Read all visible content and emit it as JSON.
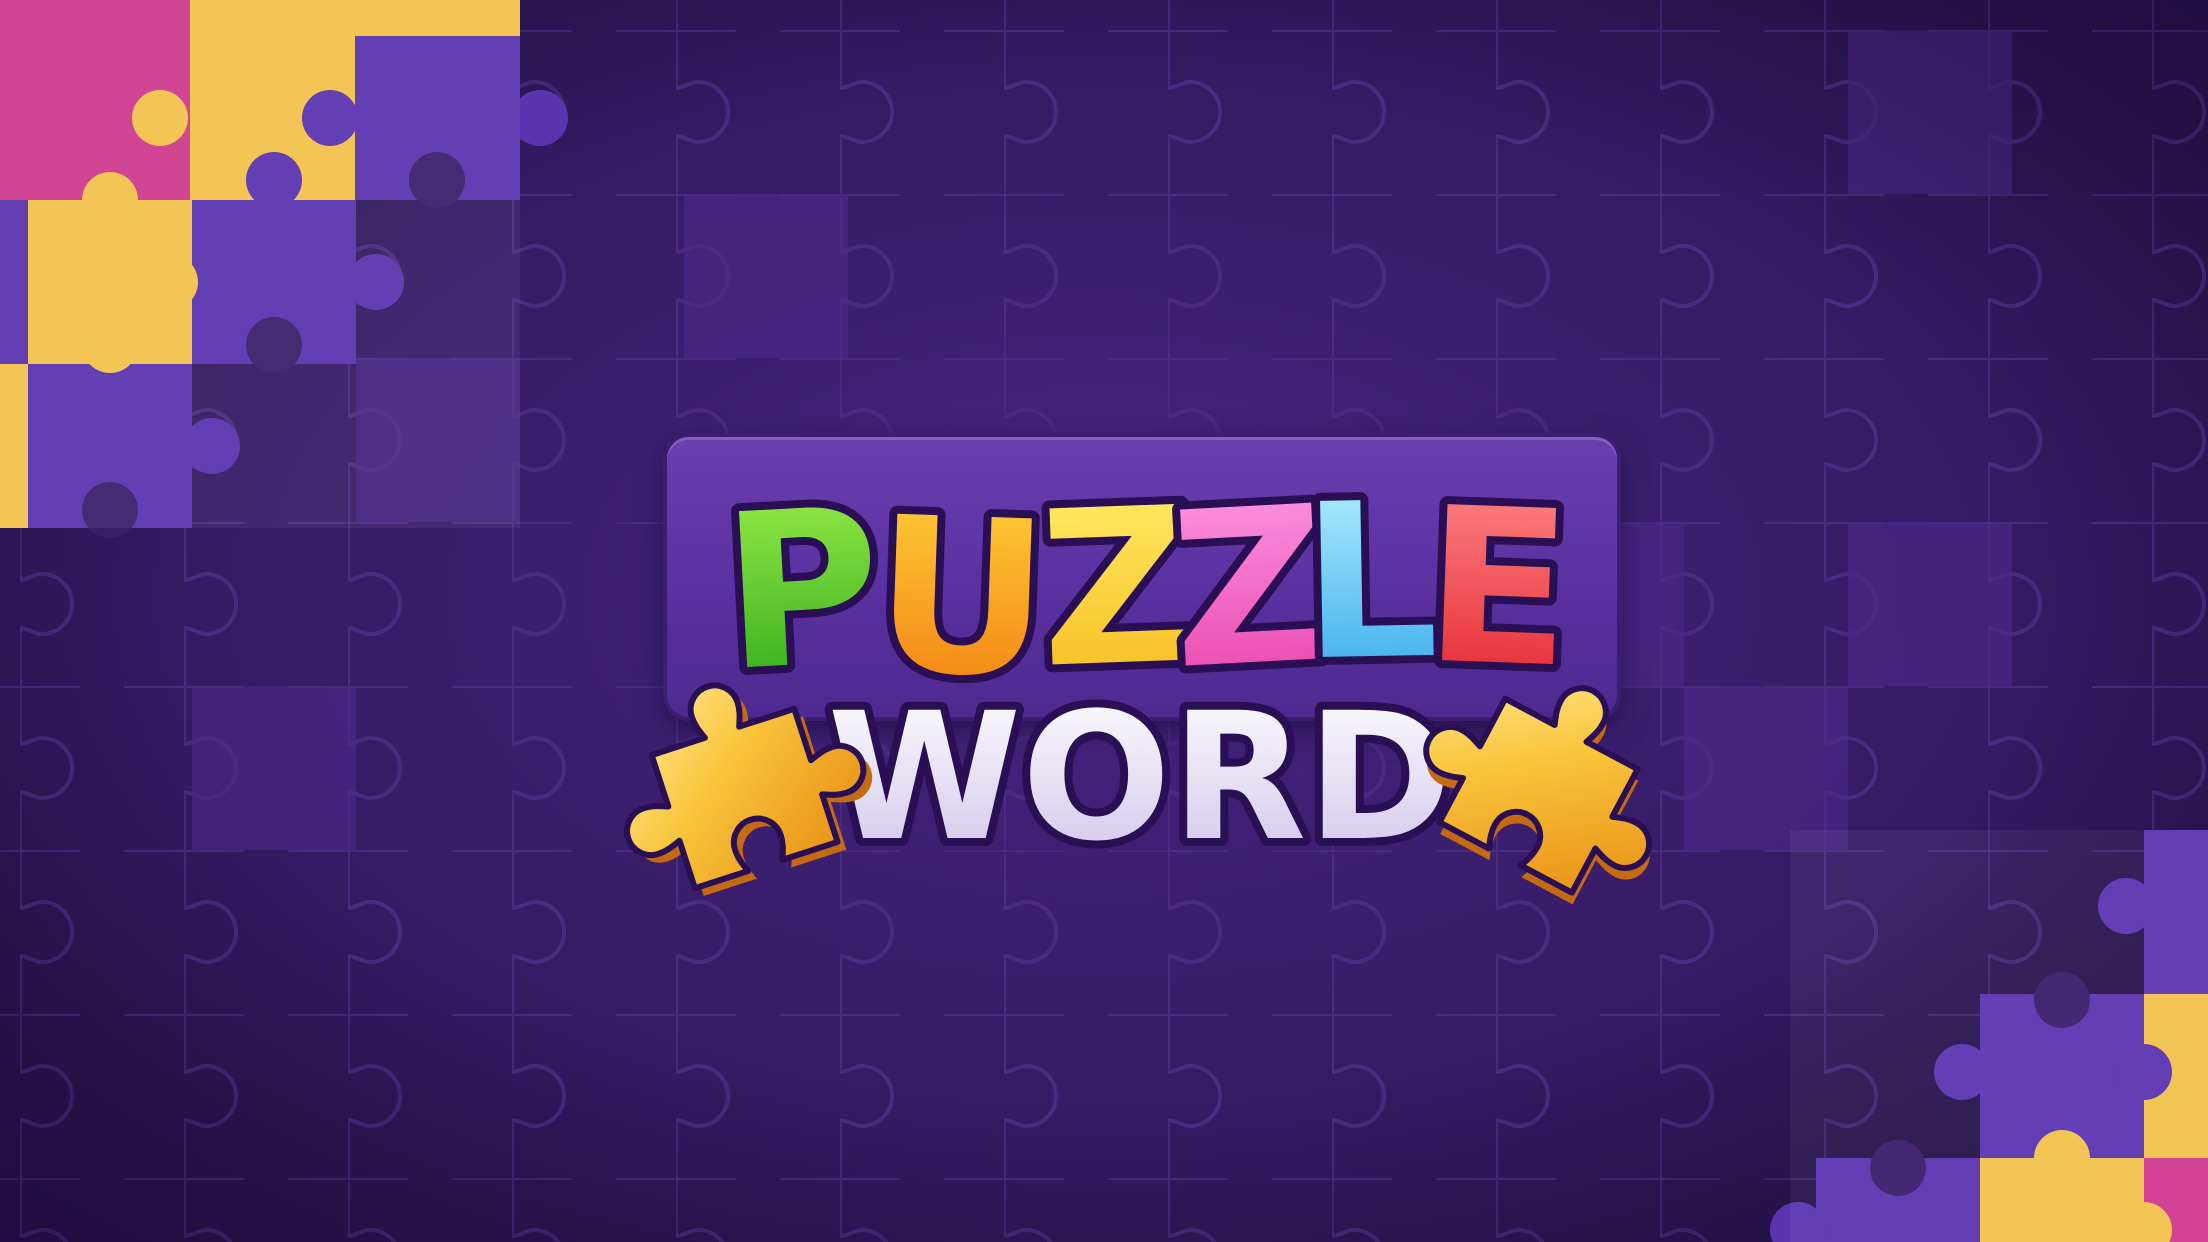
{
  "title": {
    "line1": {
      "letters": [
        {
          "char": "P",
          "color_top": "#9ef04a",
          "color_bottom": "#29a51a"
        },
        {
          "char": "U",
          "color_top": "#ffd23a",
          "color_bottom": "#f27a0e"
        },
        {
          "char": "Z",
          "color_top": "#fff06a",
          "color_bottom": "#f5b81a"
        },
        {
          "char": "Z",
          "color_top": "#ff9be6",
          "color_bottom": "#e63fa8"
        },
        {
          "char": "L",
          "color_top": "#b9f3ff",
          "color_bottom": "#2fa6ea"
        },
        {
          "char": "E",
          "color_top": "#ff8a8a",
          "color_bottom": "#e3212c"
        }
      ]
    },
    "line2": {
      "text": "WORD",
      "color_top": "#ffffff",
      "color_bottom": "#cfc3ea"
    }
  },
  "icons": {
    "left_piece": "puzzle-piece-icon",
    "right_piece": "puzzle-piece-icon"
  },
  "colors": {
    "background": "#2a1450",
    "grid_line": "#4b2a82",
    "panel": "#5a31a0",
    "outline": "#2b0f55",
    "piece_purple": "#5b34b0",
    "piece_yellow": "#f2c24c",
    "piece_pink": "#d0398e",
    "gold": "#f9c43a"
  }
}
